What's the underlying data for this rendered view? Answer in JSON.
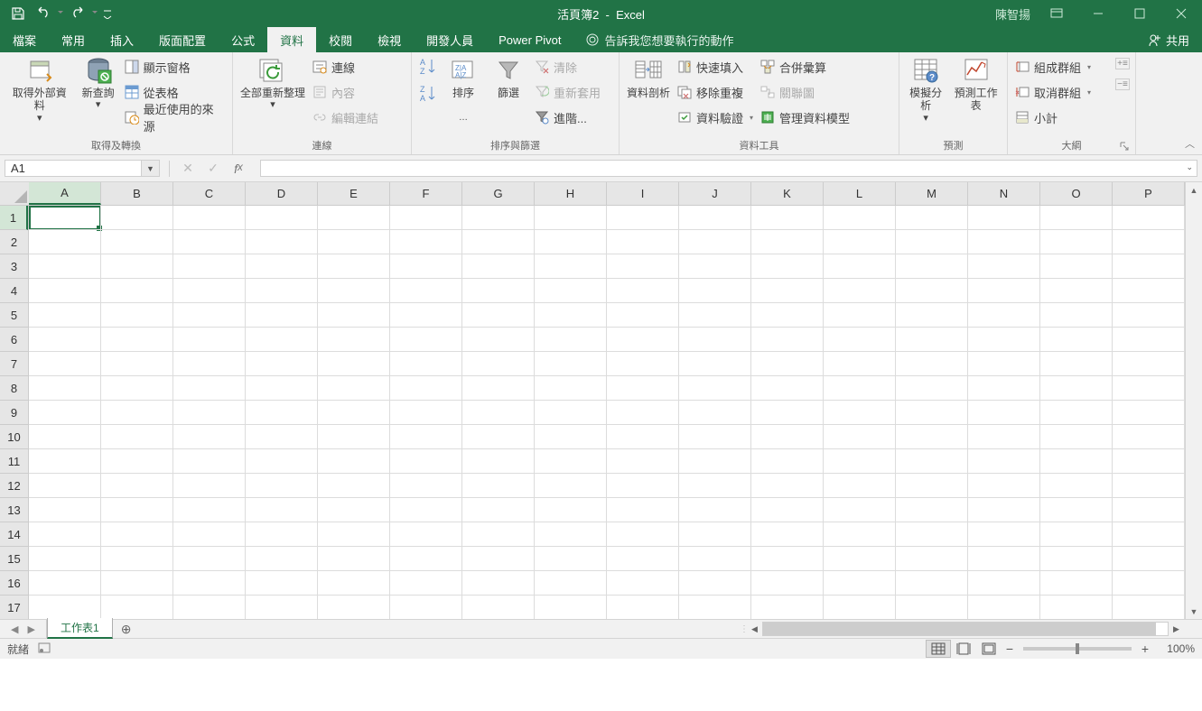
{
  "title": {
    "doc": "活頁簿2",
    "sep": "-",
    "app": "Excel"
  },
  "user": "陳智揚",
  "tabs": [
    "檔案",
    "常用",
    "插入",
    "版面配置",
    "公式",
    "資料",
    "校閱",
    "檢視",
    "開發人員",
    "Power Pivot"
  ],
  "active_tab": 5,
  "tell_me": "告訴我您想要執行的動作",
  "share": "共用",
  "ribbon": {
    "g1": {
      "label": "取得及轉換",
      "get_external": "取得外部資料",
      "new_query": "新查詢",
      "show_pane": "顯示窗格",
      "from_table": "從表格",
      "recent_sources": "最近使用的來源"
    },
    "g2": {
      "label": "連線",
      "refresh_all": "全部重新整理",
      "connections": "連線",
      "properties": "內容",
      "edit_links": "編輯連結"
    },
    "g3": {
      "label": "排序與篩選",
      "sort": "排序",
      "filter": "篩選",
      "clear": "清除",
      "reapply": "重新套用",
      "advanced": "進階..."
    },
    "g4": {
      "label": "資料工具",
      "text_to_cols": "資料剖析",
      "flash_fill": "快速填入",
      "remove_dup": "移除重複",
      "data_validation": "資料驗證",
      "consolidate": "合併彙算",
      "relationships": "關聯圖",
      "data_model": "管理資料模型"
    },
    "g5": {
      "label": "預測",
      "whatif": "模擬分析",
      "forecast": "預測工作表"
    },
    "g6": {
      "label": "大綱",
      "group": "組成群組",
      "ungroup": "取消群組",
      "subtotal": "小計"
    }
  },
  "namebox": "A1",
  "columns": [
    "A",
    "B",
    "C",
    "D",
    "E",
    "F",
    "G",
    "H",
    "I",
    "J",
    "K",
    "L",
    "M",
    "N",
    "O",
    "P"
  ],
  "rows": [
    "1",
    "2",
    "3",
    "4",
    "5",
    "6",
    "7",
    "8",
    "9",
    "10",
    "11",
    "12",
    "13",
    "14",
    "15",
    "16",
    "17"
  ],
  "sheet_tab": "工作表1",
  "status_ready": "就緒",
  "zoom_pct": "100%"
}
